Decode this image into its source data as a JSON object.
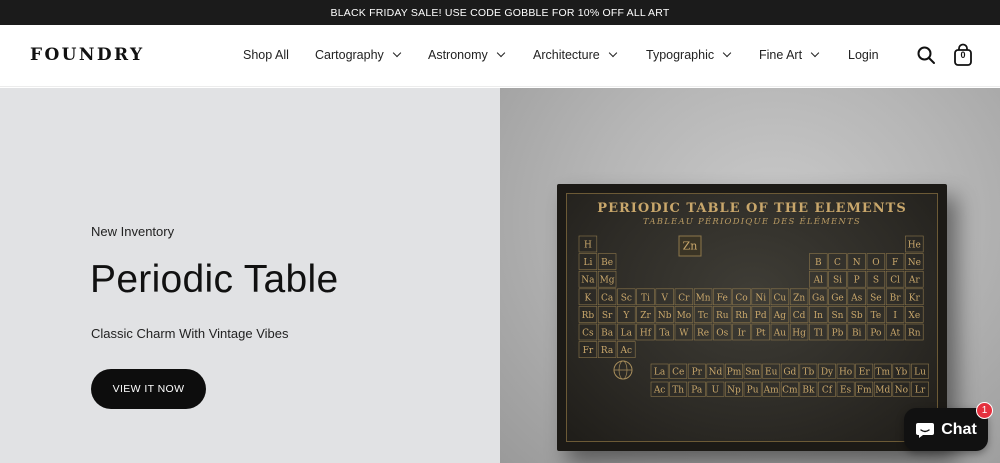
{
  "announcement": {
    "text": "BLACK FRIDAY SALE! USE CODE GOBBLE FOR 10% OFF ALL ART"
  },
  "header": {
    "logo": "FOUNDRY",
    "nav": [
      {
        "label": "Shop All",
        "has_dropdown": false
      },
      {
        "label": "Cartography",
        "has_dropdown": true
      },
      {
        "label": "Astronomy",
        "has_dropdown": true
      },
      {
        "label": "Architecture",
        "has_dropdown": true
      },
      {
        "label": "Typographic",
        "has_dropdown": true
      },
      {
        "label": "Fine Art",
        "has_dropdown": true
      },
      {
        "label": "Login",
        "has_dropdown": false
      }
    ],
    "cart_count": "0",
    "icons": {
      "search": "search-icon",
      "cart": "shopping-bag-icon"
    }
  },
  "hero": {
    "eyebrow": "New Inventory",
    "title": "Periodic Table",
    "subtitle": "Classic Charm With Vintage Vibes",
    "cta_label": "VIEW IT NOW",
    "poster": {
      "title": "PERIODIC TABLE OF THE ELEMENTS",
      "subtitle": "TABLEAU PÉRIODIQUE DES ÉLÉMENTS",
      "featured_element": "Zn",
      "rows": [
        [
          "H",
          "",
          "",
          "",
          "",
          "",
          "",
          "",
          "",
          "",
          "",
          "",
          "",
          "",
          "",
          "",
          "",
          "He"
        ],
        [
          "Li",
          "Be",
          "",
          "",
          "",
          "",
          "",
          "",
          "",
          "",
          "",
          "",
          "B",
          "C",
          "N",
          "O",
          "F",
          "Ne"
        ],
        [
          "Na",
          "Mg",
          "",
          "",
          "",
          "",
          "",
          "",
          "",
          "",
          "",
          "",
          "Al",
          "Si",
          "P",
          "S",
          "Cl",
          "Ar"
        ],
        [
          "K",
          "Ca",
          "Sc",
          "Ti",
          "V",
          "Cr",
          "Mn",
          "Fe",
          "Co",
          "Ni",
          "Cu",
          "Zn",
          "Ga",
          "Ge",
          "As",
          "Se",
          "Br",
          "Kr"
        ],
        [
          "Rb",
          "Sr",
          "Y",
          "Zr",
          "Nb",
          "Mo",
          "Tc",
          "Ru",
          "Rh",
          "Pd",
          "Ag",
          "Cd",
          "In",
          "Sn",
          "Sb",
          "Te",
          "I",
          "Xe"
        ],
        [
          "Cs",
          "Ba",
          "La",
          "Hf",
          "Ta",
          "W",
          "Re",
          "Os",
          "Ir",
          "Pt",
          "Au",
          "Hg",
          "Tl",
          "Pb",
          "Bi",
          "Po",
          "At",
          "Rn"
        ],
        [
          "Fr",
          "Ra",
          "Ac",
          "",
          "",
          "",
          "",
          "",
          "",
          "",
          "",
          "",
          "",
          "",
          "",
          "",
          "",
          ""
        ]
      ],
      "lanthanides": [
        "La",
        "Ce",
        "Pr",
        "Nd",
        "Pm",
        "Sm",
        "Eu",
        "Gd",
        "Tb",
        "Dy",
        "Ho",
        "Er",
        "Tm",
        "Yb",
        "Lu"
      ],
      "actinides": [
        "Ac",
        "Th",
        "Pa",
        "U",
        "Np",
        "Pu",
        "Am",
        "Cm",
        "Bk",
        "Cf",
        "Es",
        "Fm",
        "Md",
        "No",
        "Lr"
      ]
    }
  },
  "chat": {
    "label": "Chat",
    "badge": "1"
  },
  "colors": {
    "announcement_bg": "#1b1b1b",
    "hero_left_bg": "#e1e2e4",
    "cta_bg": "#0d0d0d",
    "poster_gold": "#c9a76b",
    "chat_badge": "#e5303e"
  }
}
